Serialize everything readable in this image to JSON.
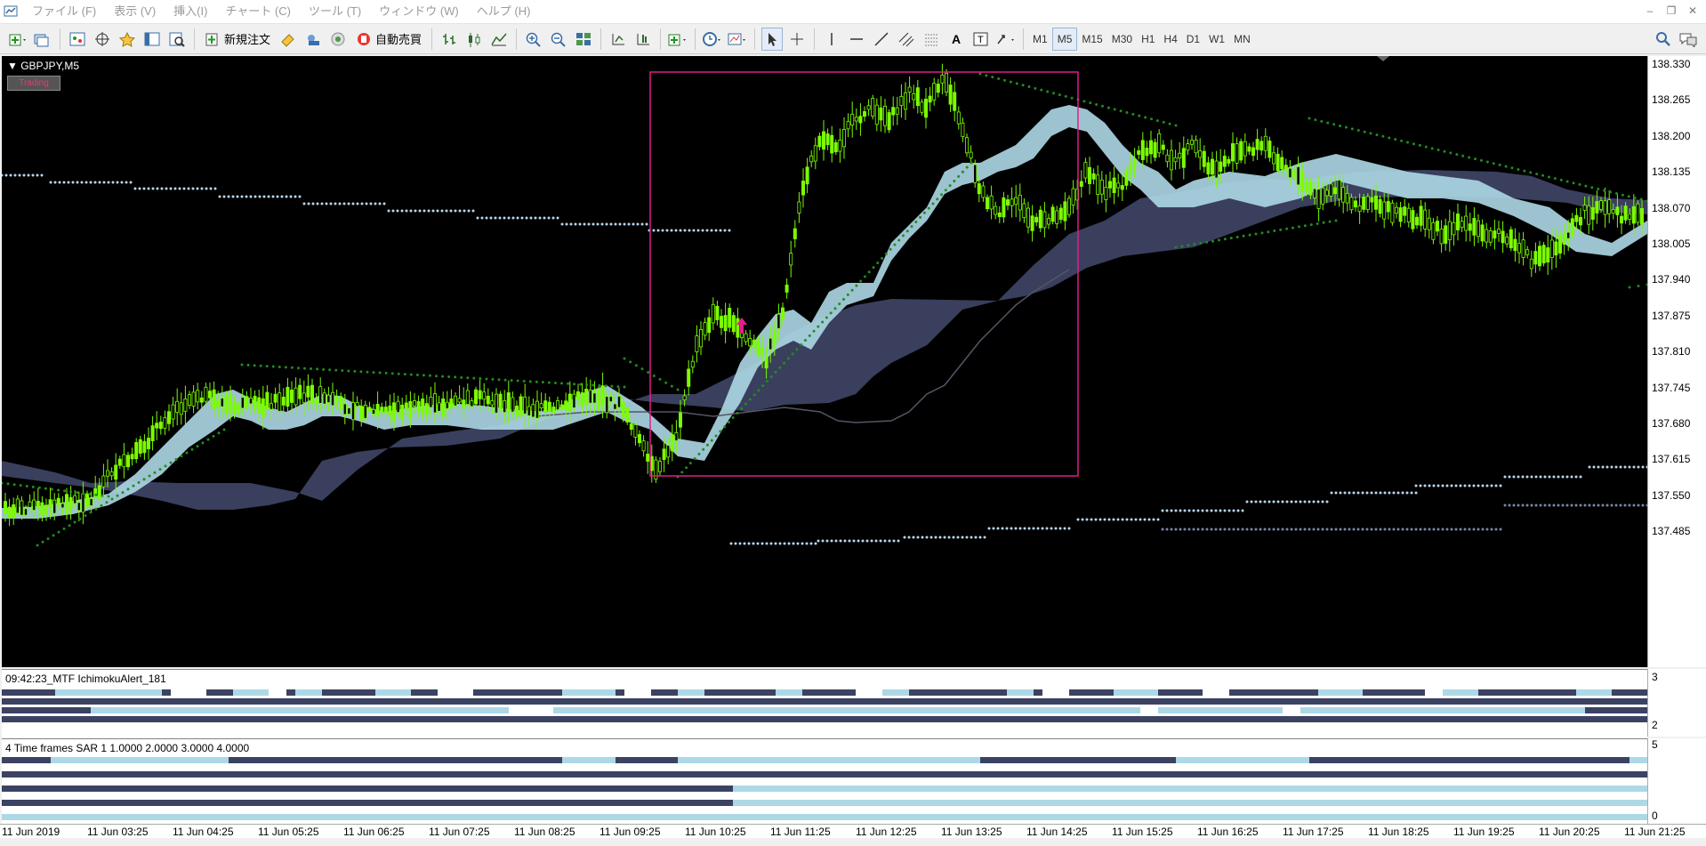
{
  "menu": [
    "ファイル (F)",
    "表示 (V)",
    "挿入(I)",
    "チャート (C)",
    "ツール (T)",
    "ウィンドウ (W)",
    "ヘルプ (H)"
  ],
  "toolbar": {
    "new_order_label": "新規注文",
    "auto_trade_label": "自動売買",
    "timeframes": [
      "M1",
      "M5",
      "M15",
      "M30",
      "H1",
      "H4",
      "D1",
      "W1",
      "MN"
    ],
    "active_timeframe": "M5"
  },
  "chart": {
    "symbol_title": "GBPJPY,M5",
    "badge_text": "Trading",
    "price_labels": [
      "138.330",
      "138.265",
      "138.200",
      "138.135",
      "138.070",
      "138.005",
      "137.940",
      "137.875",
      "137.810",
      "137.745",
      "137.680",
      "137.615",
      "137.550",
      "137.485"
    ]
  },
  "subpanels": {
    "ichimoku_title": "09:42:23_MTF IchimokuAlert_181",
    "ichimoku_axis": [
      "3",
      "2"
    ],
    "sar_title": "4 Time frames SAR 1 1.0000 2.0000 3.0000 4.0000",
    "sar_axis": [
      "5",
      "0"
    ]
  },
  "time_labels": [
    "11 Jun 2019",
    "11 Jun 03:25",
    "11 Jun 04:25",
    "11 Jun 05:25",
    "11 Jun 06:25",
    "11 Jun 07:25",
    "11 Jun 08:25",
    "11 Jun 09:25",
    "11 Jun 10:25",
    "11 Jun 11:25",
    "11 Jun 12:25",
    "11 Jun 13:25",
    "11 Jun 14:25",
    "11 Jun 15:25",
    "11 Jun 16:25",
    "11 Jun 17:25",
    "11 Jun 18:25",
    "11 Jun 19:25",
    "11 Jun 20:25",
    "11 Jun 21:25"
  ],
  "colors": {
    "candle": "#7CFC00",
    "cloud_band": "#ADD8E6",
    "kumo": "#3c4262",
    "sar_dots": "#228B22",
    "highlight_box": "#e01e8a",
    "arrow": "#e01e8a"
  }
}
